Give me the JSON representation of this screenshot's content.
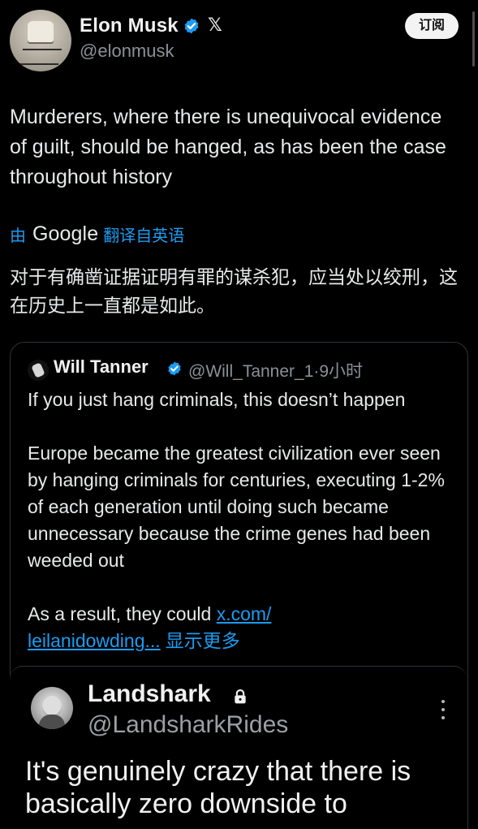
{
  "header": {
    "name": "Elon Musk",
    "handle": "@elonmusk",
    "platform_icon": "x-logo-icon",
    "subscribe_label": "订阅"
  },
  "tweet": {
    "text": "Murderers, where there is unequivocal evidence of guilt, should be hanged, as has been the case throughout history",
    "translated_prefix": "由",
    "translated_brand": "Google",
    "translated_suffix": "翻译自英语",
    "translation": "对于有确凿证据证明有罪的谋杀犯，应当处以绞刑，这在历史上一直都是如此。"
  },
  "quoted_tweet": {
    "name": "Will Tanner",
    "meta": "@Will_Tanner_1·9小时",
    "paragraph_1": "If you just hang criminals, this doesn’t happen",
    "paragraph_2": "Europe became the greatest civilization ever seen by hanging criminals for centuries, executing 1-2% of each generation until doing such became unnecessary because the crime genes had been weeded out",
    "paragraph_3_prefix": "As a result, they could ",
    "paragraph_3_link_1": "x.com/",
    "paragraph_3_link_2": "leilanidowding...",
    "show_more_label": "显示更多"
  },
  "embedded_tweet": {
    "name": "Landshark",
    "handle": "@LandsharkRides",
    "text": "It's genuinely crazy that there is basically zero downside to"
  },
  "colors": {
    "background": "#000000",
    "primary_text": "#e7e9ea",
    "secondary_text": "#8b9096",
    "accent": "#1d9bf0",
    "border": "#2f3336"
  }
}
